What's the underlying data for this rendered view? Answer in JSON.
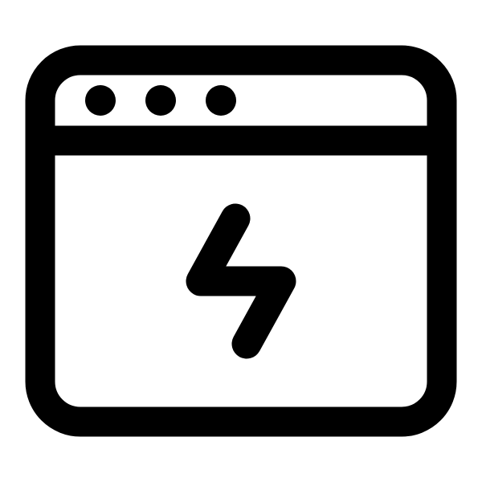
{
  "icon": {
    "name": "browser-window-lightning-icon",
    "stroke_color": "#000000",
    "background_color": "#ffffff",
    "window_control_dots": 3
  }
}
